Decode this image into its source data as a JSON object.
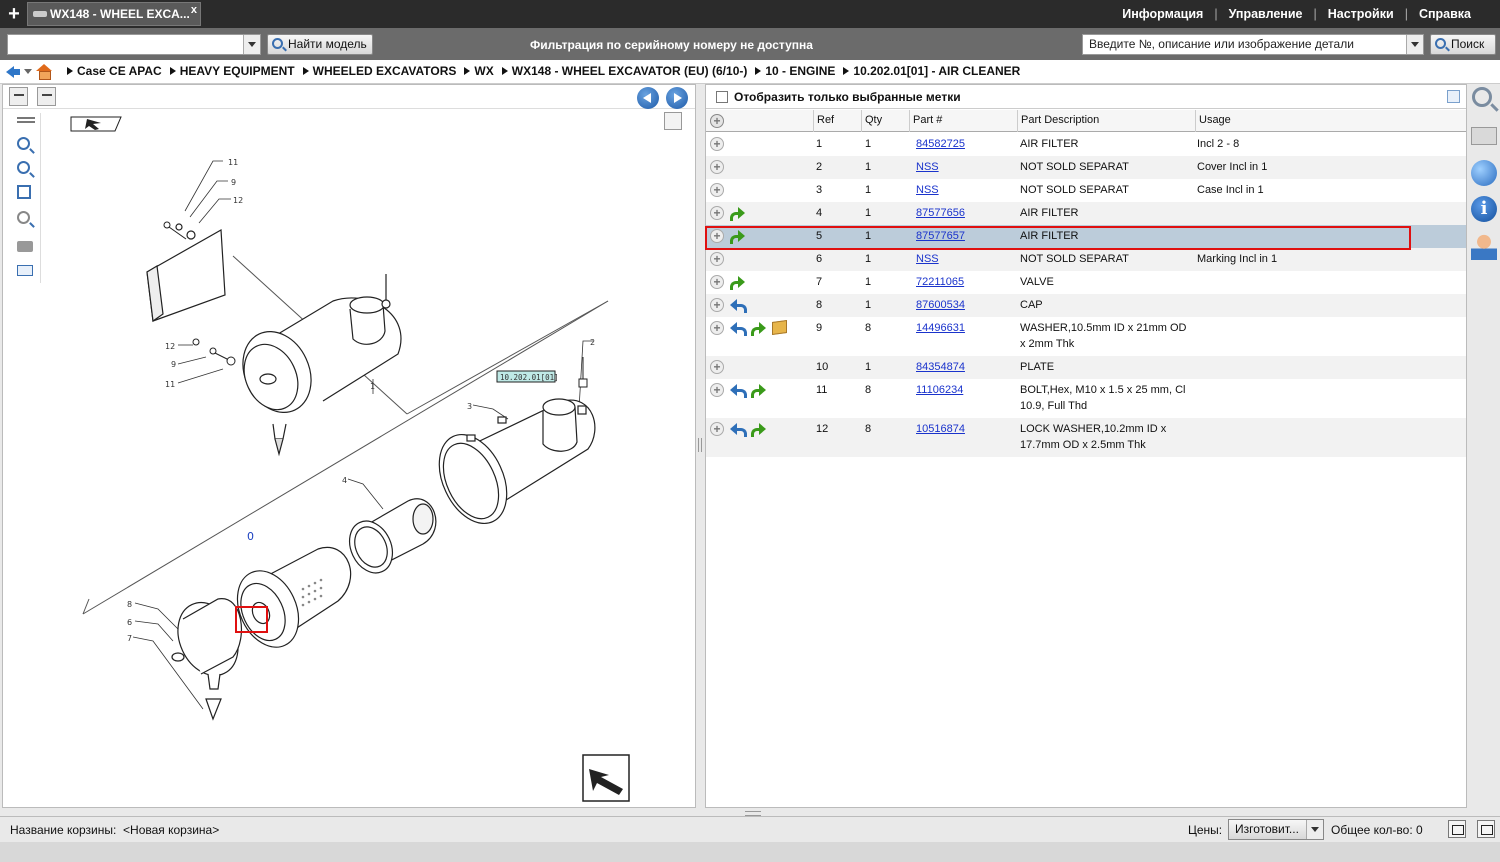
{
  "tab": {
    "title": "WX148 - WHEEL EXCA...",
    "close": "x"
  },
  "menu": {
    "items": [
      "Информация",
      "Управление",
      "Настройки",
      "Справка"
    ]
  },
  "toolbar": {
    "find_model": "Найти модель",
    "serial_note": "Фильтрация по серийному номеру не доступна",
    "part_search_placeholder": "Введите №, описание или изображение детали",
    "search": "Поиск"
  },
  "breadcrumb": [
    "Case CE APAC",
    "HEAVY EQUIPMENT",
    "WHEELED EXCAVATORS",
    "WX",
    "WX148 - WHEEL EXCAVATOR (EU) (6/10-)",
    "10 - ENGINE",
    "10.202.01[01] - AIR CLEANER"
  ],
  "filter": {
    "label": "Отобразить только выбранные метки"
  },
  "table": {
    "headers": {
      "ref": "Ref",
      "qty": "Qty",
      "part": "Part #",
      "desc": "Part Description",
      "usage": "Usage"
    },
    "rows": [
      {
        "ref": "1",
        "qty": "1",
        "part": "84582725",
        "desc": "AIR FILTER",
        "usage": "Incl 2 - 8",
        "icons": []
      },
      {
        "ref": "2",
        "qty": "1",
        "part": "NSS",
        "desc": "NOT SOLD SEPARAT",
        "usage": "Cover Incl in 1",
        "icons": []
      },
      {
        "ref": "3",
        "qty": "1",
        "part": "NSS",
        "desc": "NOT SOLD SEPARAT",
        "usage": "Case Incl in 1",
        "icons": []
      },
      {
        "ref": "4",
        "qty": "1",
        "part": "87577656",
        "desc": "AIR FILTER",
        "usage": "",
        "icons": [
          "green"
        ]
      },
      {
        "ref": "5",
        "qty": "1",
        "part": "87577657",
        "desc": "AIR FILTER",
        "usage": "",
        "icons": [
          "green"
        ]
      },
      {
        "ref": "6",
        "qty": "1",
        "part": "NSS",
        "desc": "NOT SOLD SEPARAT",
        "usage": "Marking Incl in 1",
        "icons": []
      },
      {
        "ref": "7",
        "qty": "1",
        "part": "72211065",
        "desc": "VALVE",
        "usage": "",
        "icons": [
          "green"
        ]
      },
      {
        "ref": "8",
        "qty": "1",
        "part": "87600534",
        "desc": "CAP",
        "usage": "",
        "icons": [
          "blue"
        ]
      },
      {
        "ref": "9",
        "qty": "8",
        "part": "14496631",
        "desc": "WASHER,10.5mm ID x 21mm OD x 2mm Thk",
        "usage": "",
        "icons": [
          "blue",
          "green",
          "box"
        ]
      },
      {
        "ref": "10",
        "qty": "1",
        "part": "84354874",
        "desc": "PLATE",
        "usage": "",
        "icons": []
      },
      {
        "ref": "11",
        "qty": "8",
        "part": "11106234",
        "desc": "BOLT,Hex, M10 x 1.5 x 25 mm, Cl 10.9, Full Thd",
        "usage": "",
        "icons": [
          "blue",
          "green"
        ]
      },
      {
        "ref": "12",
        "qty": "8",
        "part": "10516874",
        "desc": "LOCK WASHER,10.2mm ID x 17.7mm OD x 2.5mm Thk",
        "usage": "",
        "icons": [
          "blue",
          "green"
        ]
      }
    ],
    "selected_ref": "5"
  },
  "drawing": {
    "callouts": [
      "11",
      "9",
      "12",
      "12",
      "9",
      "11",
      "1",
      "2",
      "3",
      "4",
      "8",
      "6",
      "7",
      "0"
    ],
    "tag_label": "10.202.01[01]"
  },
  "status": {
    "basket_label": "Название корзины:",
    "basket_name": "<Новая корзина>",
    "prices_label": "Цены:",
    "prices_value": "Изготовит...",
    "total_label": "Общее кол-во:",
    "total_value": "0"
  },
  "colors": {
    "highlight": "#e01010",
    "selected_row": "#bcccda",
    "link": "#1a33cc"
  }
}
